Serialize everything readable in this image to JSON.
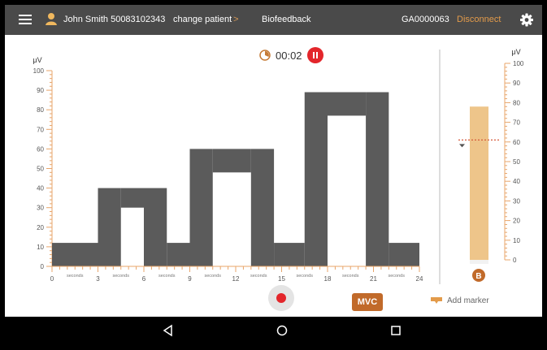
{
  "header": {
    "patient": "John Smith 50083102343",
    "change_patient": "change patient",
    "change_chevron": ">",
    "title": "Biofeedback",
    "device_id": "GA0000063",
    "disconnect": "Disconnect"
  },
  "timer": {
    "value": "00:02"
  },
  "controls": {
    "mvc": "MVC",
    "add_marker": "Add marker"
  },
  "colors": {
    "accent": "#E39B4A",
    "record": "#E3262B",
    "bar": "#5B5B5B",
    "meter": "#EEC58A"
  },
  "chart_data": [
    {
      "type": "area",
      "ylabel": "μV",
      "xlabel": "seconds",
      "ylim": [
        0,
        100
      ],
      "xlim": [
        0,
        24
      ],
      "yticks": [
        0,
        10,
        20,
        30,
        40,
        50,
        60,
        70,
        80,
        90,
        100
      ],
      "xticks": [
        0,
        3,
        6,
        9,
        12,
        15,
        18,
        21,
        24
      ],
      "segments": [
        {
          "x": [
            0,
            3
          ],
          "min": 0,
          "max": 12
        },
        {
          "x": [
            3,
            4.5
          ],
          "min": 0,
          "max": 40
        },
        {
          "x": [
            4.5,
            6
          ],
          "min": 30,
          "max": 40
        },
        {
          "x": [
            6,
            7.5
          ],
          "min": 0,
          "max": 40
        },
        {
          "x": [
            7.5,
            9
          ],
          "min": 0,
          "max": 12
        },
        {
          "x": [
            9,
            10.5
          ],
          "min": 0,
          "max": 60
        },
        {
          "x": [
            10.5,
            13
          ],
          "min": 48,
          "max": 60
        },
        {
          "x": [
            13,
            14.5
          ],
          "min": 0,
          "max": 60
        },
        {
          "x": [
            14.5,
            16.5
          ],
          "min": 0,
          "max": 12
        },
        {
          "x": [
            16.5,
            18
          ],
          "min": 0,
          "max": 89
        },
        {
          "x": [
            18,
            20.5
          ],
          "min": 77,
          "max": 89
        },
        {
          "x": [
            20.5,
            22
          ],
          "min": 0,
          "max": 89
        },
        {
          "x": [
            22,
            24
          ],
          "min": 0,
          "max": 12
        }
      ]
    },
    {
      "type": "bar",
      "ylabel": "μV",
      "ylim": [
        0,
        100
      ],
      "yticks": [
        0,
        10,
        20,
        30,
        40,
        50,
        60,
        70,
        80,
        90,
        100
      ],
      "level": 78,
      "threshold": 61,
      "channel": "B"
    }
  ]
}
